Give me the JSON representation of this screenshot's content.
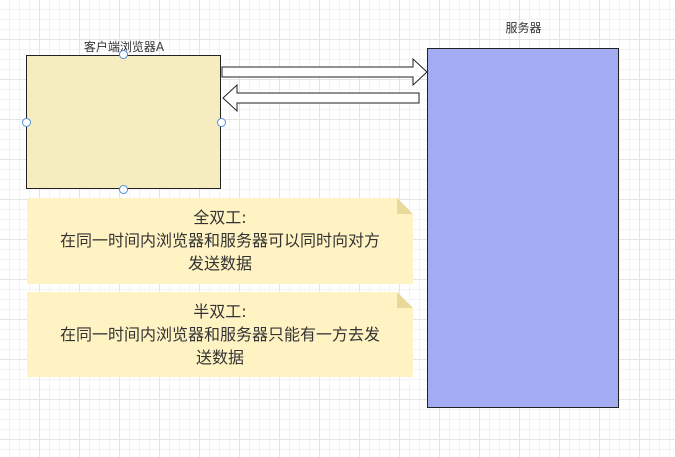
{
  "diagram": {
    "client": {
      "label": "客户端浏览器A",
      "fill": "#f5ecc0"
    },
    "server": {
      "label": "服务器",
      "fill": "#a3acf2"
    },
    "arrows": [
      {
        "from": "client",
        "to": "server",
        "style": "hollow-block"
      },
      {
        "from": "server",
        "to": "client",
        "style": "hollow-block"
      }
    ],
    "notes": [
      {
        "title": "全双工:",
        "lines": [
          "在同一时间内浏览器和服务器可以同时向对方",
          "发送数据"
        ],
        "fill": "#fff3c4",
        "fold": "#e8d89a"
      },
      {
        "title": "半双工:",
        "lines": [
          "在同一时间内浏览器和服务器只能有一方去发",
          "送数据"
        ],
        "fill": "#fff3c4",
        "fold": "#e8d89a"
      }
    ],
    "selection_handle_color": "#4a8fe0"
  }
}
